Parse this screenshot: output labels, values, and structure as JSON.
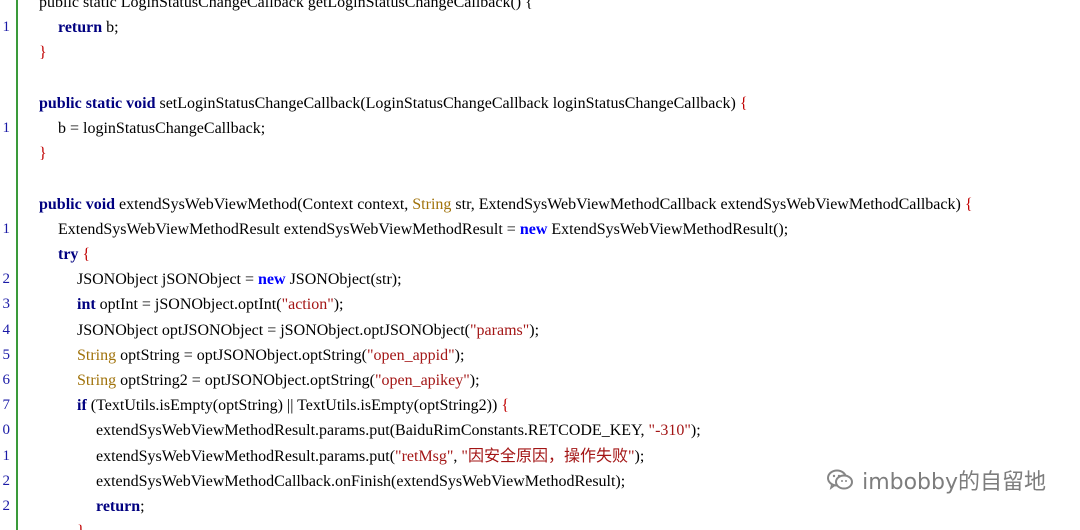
{
  "code_lines": [
    {
      "ln": "",
      "indent": 2,
      "segments": [
        {
          "t": "public static LoginStatusChangeCallback getLoginStatusChangeCallback() {",
          "c": "plain"
        }
      ]
    },
    {
      "ln": "1",
      "indent": 3,
      "segments": [
        {
          "t": "return",
          "c": "kw"
        },
        {
          "t": " b;",
          "c": "plain"
        }
      ]
    },
    {
      "ln": "",
      "indent": 2,
      "segments": [
        {
          "t": "}",
          "c": "brace"
        }
      ]
    },
    {
      "ln": "",
      "indent": 0,
      "segments": []
    },
    {
      "ln": "",
      "indent": 2,
      "segments": [
        {
          "t": "public static void",
          "c": "kw"
        },
        {
          "t": " setLoginStatusChangeCallback(LoginStatusChangeCallback loginStatusChangeCallback) ",
          "c": "plain"
        },
        {
          "t": "{",
          "c": "brace"
        }
      ]
    },
    {
      "ln": "1",
      "indent": 3,
      "segments": [
        {
          "t": "b = loginStatusChangeCallback;",
          "c": "plain"
        }
      ]
    },
    {
      "ln": "",
      "indent": 2,
      "segments": [
        {
          "t": "}",
          "c": "brace"
        }
      ]
    },
    {
      "ln": "",
      "indent": 0,
      "segments": []
    },
    {
      "ln": "",
      "indent": 2,
      "segments": [
        {
          "t": "public void",
          "c": "kw"
        },
        {
          "t": " extendSysWebViewMethod(Context context, ",
          "c": "plain"
        },
        {
          "t": "String",
          "c": "type"
        },
        {
          "t": " str, ExtendSysWebViewMethodCallback extendSysWebViewMethodCallback) ",
          "c": "plain"
        },
        {
          "t": "{",
          "c": "brace"
        }
      ]
    },
    {
      "ln": "1",
      "indent": 3,
      "segments": [
        {
          "t": "ExtendSysWebViewMethodResult extendSysWebViewMethodResult = ",
          "c": "plain"
        },
        {
          "t": "new",
          "c": "kw2"
        },
        {
          "t": " ExtendSysWebViewMethodResult();",
          "c": "plain"
        }
      ]
    },
    {
      "ln": "",
      "indent": 3,
      "segments": [
        {
          "t": "try",
          "c": "kw"
        },
        {
          "t": " ",
          "c": "plain"
        },
        {
          "t": "{",
          "c": "brace"
        }
      ]
    },
    {
      "ln": "2",
      "indent": 4,
      "segments": [
        {
          "t": "JSONObject jSONObject = ",
          "c": "plain"
        },
        {
          "t": "new",
          "c": "kw2"
        },
        {
          "t": " JSONObject(str);",
          "c": "plain"
        }
      ]
    },
    {
      "ln": "3",
      "indent": 4,
      "segments": [
        {
          "t": "int",
          "c": "kw"
        },
        {
          "t": " optInt = jSONObject.optInt(",
          "c": "plain"
        },
        {
          "t": "\"action\"",
          "c": "str"
        },
        {
          "t": ");",
          "c": "plain"
        }
      ]
    },
    {
      "ln": "4",
      "indent": 4,
      "segments": [
        {
          "t": "JSONObject optJSONObject = jSONObject.optJSONObject(",
          "c": "plain"
        },
        {
          "t": "\"params\"",
          "c": "str"
        },
        {
          "t": ");",
          "c": "plain"
        }
      ]
    },
    {
      "ln": "5",
      "indent": 4,
      "segments": [
        {
          "t": "String",
          "c": "type"
        },
        {
          "t": " optString = optJSONObject.optString(",
          "c": "plain"
        },
        {
          "t": "\"open_appid\"",
          "c": "str"
        },
        {
          "t": ");",
          "c": "plain"
        }
      ]
    },
    {
      "ln": "6",
      "indent": 4,
      "segments": [
        {
          "t": "String",
          "c": "type"
        },
        {
          "t": " optString2 = optJSONObject.optString(",
          "c": "plain"
        },
        {
          "t": "\"open_apikey\"",
          "c": "str"
        },
        {
          "t": ");",
          "c": "plain"
        }
      ]
    },
    {
      "ln": "7",
      "indent": 4,
      "segments": [
        {
          "t": "if",
          "c": "kw"
        },
        {
          "t": " (TextUtils.isEmpty(optString) || TextUtils.isEmpty(optString2)) ",
          "c": "plain"
        },
        {
          "t": "{",
          "c": "brace"
        }
      ]
    },
    {
      "ln": "0",
      "indent": 5,
      "segments": [
        {
          "t": "extendSysWebViewMethodResult.params.put(BaiduRimConstants.RETCODE_KEY, ",
          "c": "plain"
        },
        {
          "t": "\"-310\"",
          "c": "str"
        },
        {
          "t": ");",
          "c": "plain"
        }
      ]
    },
    {
      "ln": "1",
      "indent": 5,
      "segments": [
        {
          "t": "extendSysWebViewMethodResult.params.put(",
          "c": "plain"
        },
        {
          "t": "\"retMsg\"",
          "c": "str"
        },
        {
          "t": ", ",
          "c": "plain"
        },
        {
          "t": "\"因安全原因，操作失败\"",
          "c": "str"
        },
        {
          "t": ");",
          "c": "plain"
        }
      ]
    },
    {
      "ln": "2",
      "indent": 5,
      "segments": [
        {
          "t": "extendSysWebViewMethodCallback.onFinish(extendSysWebViewMethodResult);",
          "c": "plain"
        }
      ]
    },
    {
      "ln": "2",
      "indent": 5,
      "segments": [
        {
          "t": "return",
          "c": "kw"
        },
        {
          "t": ";",
          "c": "plain"
        }
      ]
    },
    {
      "ln": "",
      "indent": 4,
      "segments": [
        {
          "t": "}",
          "c": "brace"
        }
      ]
    }
  ],
  "watermark": {
    "text": "imbobby的自留地",
    "icon": "wechat-icon"
  },
  "colors": {
    "gutter_line": "#3a9a3a",
    "keyword": "#000080",
    "new_keyword": "#0000ff",
    "string": "#a31515",
    "type": "#a0720a",
    "brace": "#c00000",
    "line_number": "#1a1aa6"
  }
}
